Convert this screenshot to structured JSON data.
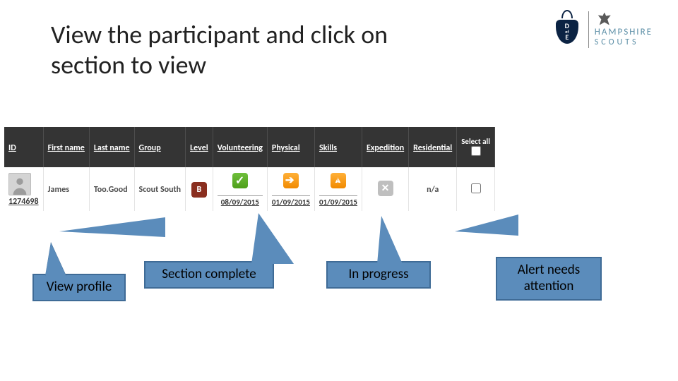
{
  "title": "View the participant and click on section to view",
  "logos": {
    "dofe_text_top": "D",
    "dofe_text_mid": "of",
    "dofe_text_bot": "E",
    "scouts_top": "HAMPSHIRE",
    "scouts_bot": "SCOUTS"
  },
  "table": {
    "headers": {
      "id": "ID",
      "first_name": "First name",
      "last_name": "Last name",
      "group": "Group",
      "level": "Level",
      "volunteering": "Volunteering",
      "physical": "Physical",
      "skills": "Skills",
      "expedition": "Expedition",
      "residential": "Residential",
      "select_all": "Select all"
    },
    "row": {
      "id": "1274698",
      "first_name": "James",
      "last_name": "Too.Good",
      "group": "Scout South",
      "level_label": "B",
      "volunteering_date": "08/09/2015",
      "physical_date": "01/09/2015",
      "skills_date": "01/09/2015",
      "residential": "n/a"
    }
  },
  "callouts": {
    "view_profile": "View profile",
    "section_complete": "Section complete",
    "in_progress": "In progress",
    "alert": "Alert needs attention"
  }
}
